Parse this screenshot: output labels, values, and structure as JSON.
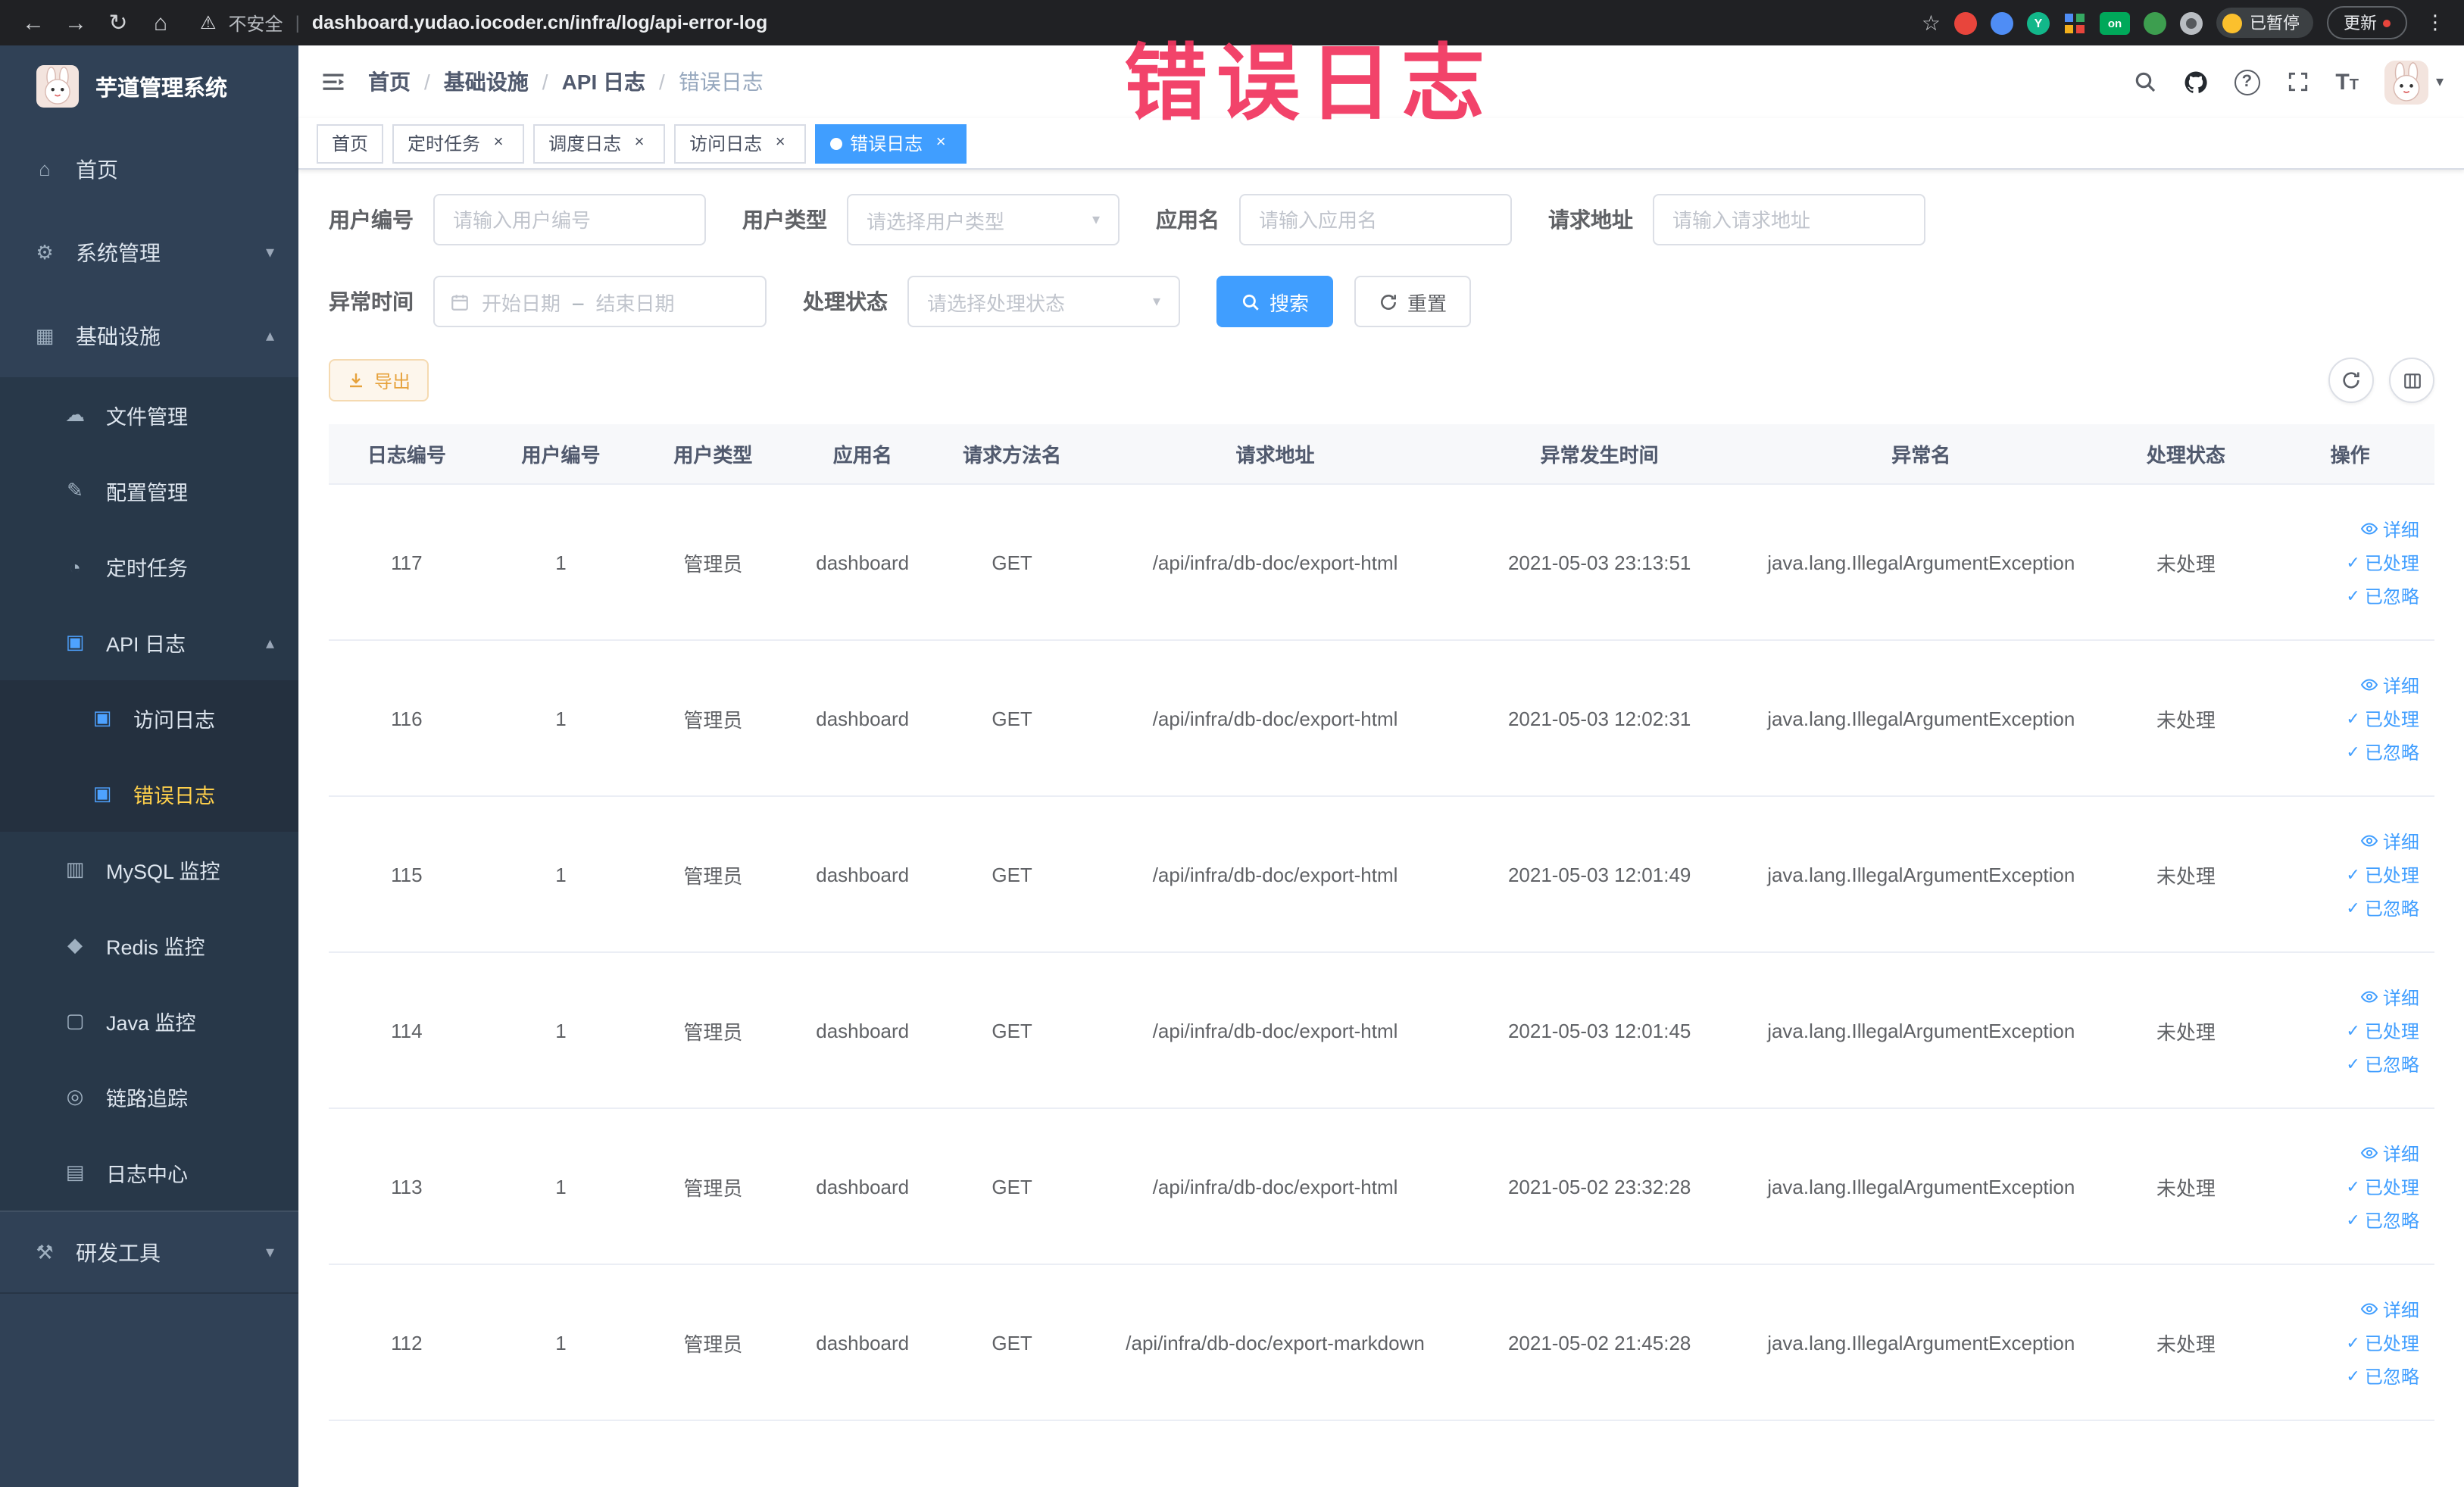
{
  "colors": {
    "accent": "#409eff",
    "warning": "#e6a23c",
    "sidebar_bg": "#304156",
    "active_menu_text": "#ffd04b",
    "annotation": "#f2355f"
  },
  "browser": {
    "security_label": "不安全",
    "url": "dashboard.yudao.iocoder.cn/infra/log/api-error-log",
    "ext_y_badge": "Y",
    "ext_on_badge": "on",
    "paused_badge": "已暂停",
    "update_label": "更新"
  },
  "sidebar": {
    "logo_title": "芋道管理系统",
    "items": [
      {
        "icon": "⌂",
        "label": "首页"
      },
      {
        "icon": "⚙",
        "label": "系统管理",
        "chevron": "▾"
      },
      {
        "icon": "▦",
        "label": "基础设施",
        "chevron": "▴"
      },
      {
        "icon": "☁",
        "label": "文件管理"
      },
      {
        "icon": "✎",
        "label": "配置管理"
      },
      {
        "icon": "◔",
        "label": "定时任务"
      },
      {
        "icon": "▣",
        "label": "API 日志",
        "chevron": "▴"
      },
      {
        "icon": "▣",
        "label": "访问日志"
      },
      {
        "icon": "▣",
        "label": "错误日志"
      },
      {
        "icon": "▥",
        "label": "MySQL 监控"
      },
      {
        "icon": "◆",
        "label": "Redis 监控"
      },
      {
        "icon": "▢",
        "label": "Java 监控"
      },
      {
        "icon": "◎",
        "label": "链路追踪"
      },
      {
        "icon": "▤",
        "label": "日志中心"
      },
      {
        "icon": "⚒",
        "label": "研发工具",
        "chevron": "▾"
      }
    ]
  },
  "header": {
    "breadcrumb": [
      "首页",
      "基础设施",
      "API 日志",
      "错误日志"
    ]
  },
  "annotation": "错误日志",
  "tabs": [
    {
      "label": "首页"
    },
    {
      "label": "定时任务"
    },
    {
      "label": "调度日志"
    },
    {
      "label": "访问日志"
    },
    {
      "label": "错误日志"
    }
  ],
  "filters": {
    "user_id": {
      "label": "用户编号",
      "placeholder": "请输入用户编号"
    },
    "user_type": {
      "label": "用户类型",
      "placeholder": "请选择用户类型"
    },
    "app_name": {
      "label": "应用名",
      "placeholder": "请输入应用名"
    },
    "request_url": {
      "label": "请求地址",
      "placeholder": "请输入请求地址"
    },
    "exception_time": {
      "label": "异常时间",
      "start_placeholder": "开始日期",
      "separator": "–",
      "end_placeholder": "结束日期"
    },
    "process_status": {
      "label": "处理状态",
      "placeholder": "请选择处理状态"
    },
    "search_label": "搜索",
    "reset_label": "重置"
  },
  "toolbar": {
    "export_label": "导出"
  },
  "table": {
    "columns": [
      "日志编号",
      "用户编号",
      "用户类型",
      "应用名",
      "请求方法名",
      "请求地址",
      "异常发生时间",
      "异常名",
      "处理状态",
      "操作"
    ],
    "actions": {
      "detail": "详细",
      "processed": "已处理",
      "ignored": "已忽略"
    },
    "rows": [
      {
        "id": "117",
        "user_id": "1",
        "user_type": "管理员",
        "app": "dashboard",
        "method": "GET",
        "url": "/api/infra/db-doc/export-html",
        "time": "2021-05-03 23:13:51",
        "exception": "java.lang.IllegalArgumentException",
        "status": "未处理"
      },
      {
        "id": "116",
        "user_id": "1",
        "user_type": "管理员",
        "app": "dashboard",
        "method": "GET",
        "url": "/api/infra/db-doc/export-html",
        "time": "2021-05-03 12:02:31",
        "exception": "java.lang.IllegalArgumentException",
        "status": "未处理"
      },
      {
        "id": "115",
        "user_id": "1",
        "user_type": "管理员",
        "app": "dashboard",
        "method": "GET",
        "url": "/api/infra/db-doc/export-html",
        "time": "2021-05-03 12:01:49",
        "exception": "java.lang.IllegalArgumentException",
        "status": "未处理"
      },
      {
        "id": "114",
        "user_id": "1",
        "user_type": "管理员",
        "app": "dashboard",
        "method": "GET",
        "url": "/api/infra/db-doc/export-html",
        "time": "2021-05-03 12:01:45",
        "exception": "java.lang.IllegalArgumentException",
        "status": "未处理"
      },
      {
        "id": "113",
        "user_id": "1",
        "user_type": "管理员",
        "app": "dashboard",
        "method": "GET",
        "url": "/api/infra/db-doc/export-html",
        "time": "2021-05-02 23:32:28",
        "exception": "java.lang.IllegalArgumentException",
        "status": "未处理"
      },
      {
        "id": "112",
        "user_id": "1",
        "user_type": "管理员",
        "app": "dashboard",
        "method": "GET",
        "url": "/api/infra/db-doc/export-markdown",
        "time": "2021-05-02 21:45:28",
        "exception": "java.lang.IllegalArgumentException",
        "status": "未处理"
      }
    ]
  }
}
